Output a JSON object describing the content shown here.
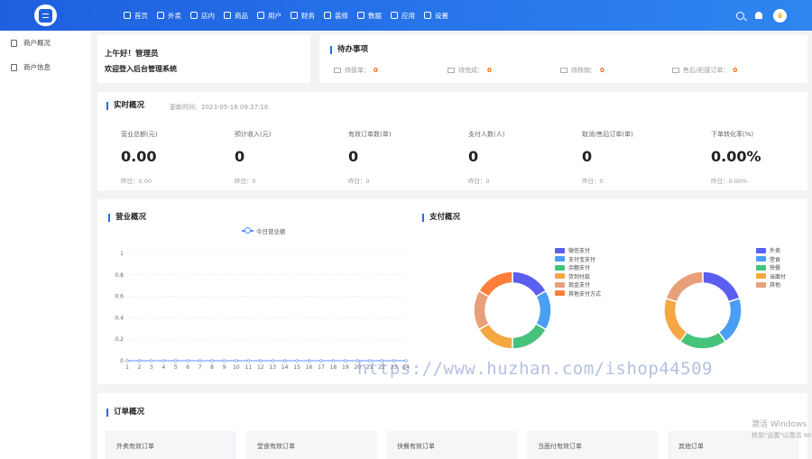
{
  "topbar": {
    "nav": [
      {
        "label": "首页",
        "icon": "home-icon"
      },
      {
        "label": "外卖",
        "icon": "takeaway-icon"
      },
      {
        "label": "店内",
        "icon": "store-icon"
      },
      {
        "label": "商品",
        "icon": "goods-icon"
      },
      {
        "label": "用户",
        "icon": "user-icon"
      },
      {
        "label": "财务",
        "icon": "finance-icon"
      },
      {
        "label": "装修",
        "icon": "decorate-icon"
      },
      {
        "label": "数据",
        "icon": "data-icon"
      },
      {
        "label": "应用",
        "icon": "apps-icon"
      },
      {
        "label": "设置",
        "icon": "settings-icon"
      }
    ]
  },
  "sidebar": {
    "items": [
      {
        "label": "商户概况",
        "icon": "overview-icon"
      },
      {
        "label": "商户信息",
        "icon": "info-icon"
      }
    ]
  },
  "welcome": {
    "line1": "上午好！管理员",
    "line2": "欢迎登入后台管理系统"
  },
  "todo": {
    "title": "待办事项",
    "items": [
      {
        "label": "待接单：",
        "count": "0"
      },
      {
        "label": "待完成：",
        "count": "0"
      },
      {
        "label": "待核销：",
        "count": "0"
      },
      {
        "label": "售后/拒接订单：",
        "count": "0"
      }
    ]
  },
  "realtime": {
    "title": "实时概况",
    "update": "更新时间：2023-05-16 09:37:16",
    "metrics": [
      {
        "label": "营业总额(元)",
        "value": "0.00",
        "yesterday": "昨日：0.00"
      },
      {
        "label": "预计收入(元)",
        "value": "0",
        "yesterday": "昨日：0"
      },
      {
        "label": "有效订单数(单)",
        "value": "0",
        "yesterday": "昨日：0"
      },
      {
        "label": "支付人数(人)",
        "value": "0",
        "yesterday": "昨日：0"
      },
      {
        "label": "取消/售后订单(单)",
        "value": "0",
        "yesterday": "昨日：0"
      },
      {
        "label": "下单转化率(%)",
        "value": "0.00%",
        "yesterday": "昨日：0.00%"
      }
    ]
  },
  "business": {
    "title": "营业概况",
    "legend": "今日营业额"
  },
  "payment": {
    "title": "支付概况",
    "legend1": [
      {
        "label": "微信支付",
        "color": "#5b5ff0"
      },
      {
        "label": "支付宝支付",
        "color": "#4a9ff5"
      },
      {
        "label": "余额支付",
        "color": "#46c37b"
      },
      {
        "label": "货到付款",
        "color": "#f5a742"
      },
      {
        "label": "现金支付",
        "color": "#e8a07a"
      },
      {
        "label": "其他支付方式",
        "color": "#ff7e3a"
      }
    ],
    "legend2": [
      {
        "label": "外卖",
        "color": "#5b5ff0"
      },
      {
        "label": "堂食",
        "color": "#4a9ff5"
      },
      {
        "label": "快餐",
        "color": "#46c37b"
      },
      {
        "label": "当面付",
        "color": "#f5a742"
      },
      {
        "label": "其他",
        "color": "#e8a07a"
      }
    ]
  },
  "chart_data": [
    {
      "type": "line",
      "title": "",
      "series": [
        {
          "name": "今日营业额",
          "values": [
            0,
            0,
            0,
            0,
            0,
            0,
            0,
            0,
            0,
            0,
            0,
            0,
            0,
            0,
            0,
            0,
            0,
            0,
            0,
            0,
            0,
            0,
            0,
            0
          ]
        }
      ],
      "x": [
        1,
        2,
        3,
        4,
        5,
        6,
        7,
        8,
        9,
        10,
        11,
        12,
        13,
        14,
        15,
        16,
        17,
        18,
        19,
        20,
        21,
        22,
        23,
        24
      ],
      "ylim": [
        0,
        1
      ],
      "yticks": [
        "0",
        "0.2",
        "0.4",
        "0.6",
        "0.8",
        "1"
      ],
      "grid": true,
      "legend": "top"
    },
    {
      "type": "pie",
      "labels": [
        "微信支付",
        "支付宝支付",
        "余额支付",
        "货到付款",
        "现金支付",
        "其他支付方式"
      ],
      "values": [
        1,
        1,
        1,
        1,
        1,
        1
      ],
      "colors": [
        "#5b5ff0",
        "#4a9ff5",
        "#46c37b",
        "#f5a742",
        "#e8a07a",
        "#ff7e3a"
      ],
      "legend": "top-right"
    },
    {
      "type": "pie",
      "labels": [
        "外卖",
        "堂食",
        "快餐",
        "当面付",
        "其他"
      ],
      "values": [
        1,
        1,
        1,
        1,
        1
      ],
      "colors": [
        "#5b5ff0",
        "#4a9ff5",
        "#46c37b",
        "#f5a742",
        "#e8a07a"
      ],
      "legend": "top-right"
    }
  ],
  "orders": {
    "title": "订单概况",
    "boxes": [
      {
        "label": "外卖有效订单"
      },
      {
        "label": "堂食有效订单"
      },
      {
        "label": "快餐有效订单"
      },
      {
        "label": "当面付有效订单"
      },
      {
        "label": "其他订单"
      }
    ]
  },
  "watermark": "https://www.huzhan.com/ishop44509",
  "windows": {
    "line1": "激活 Windows",
    "line2": "转到\"设置\"以激活 Wi"
  }
}
